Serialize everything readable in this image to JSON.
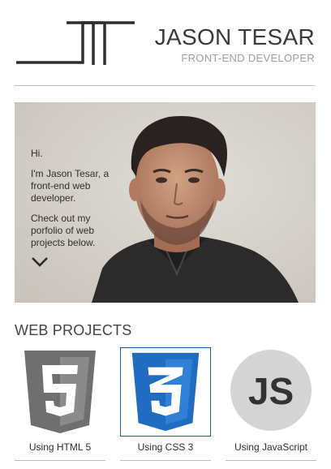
{
  "header": {
    "name": "JASON TESAR",
    "subtitle": "FRONT-END DEVELOPER"
  },
  "hero": {
    "greeting": "Hi.",
    "intro": "I'm Jason Tesar, a front-end web developer.",
    "cta": "Check out my porfolio of web projects below."
  },
  "projects": {
    "title": "WEB PROJECTS",
    "items": [
      {
        "label": "Using HTML 5",
        "badge": "5",
        "selected": false
      },
      {
        "label": "Using CSS 3",
        "badge": "3",
        "selected": true
      },
      {
        "label": "Using JavaScript",
        "badge": "JS",
        "selected": false
      }
    ]
  },
  "colors": {
    "text": "#333333",
    "muted": "#a0a0a0",
    "rule": "#bdbdbd",
    "html_badge": "#6f6f6f",
    "css_badge": "#1f6cc1",
    "js_badge": "#d4d4d4",
    "selected_border": "#1f5b97"
  },
  "icons": [
    "logo-monogram",
    "chevron-down-icon",
    "html5-icon",
    "css3-icon",
    "js-icon"
  ]
}
